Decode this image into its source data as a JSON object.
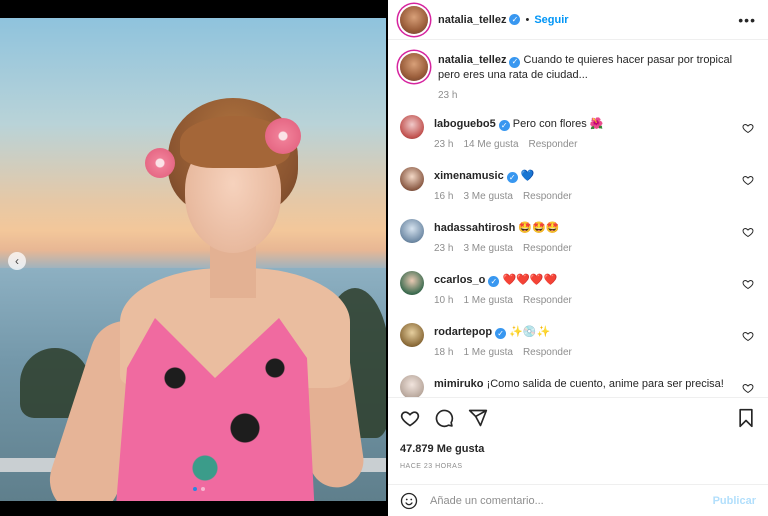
{
  "post": {
    "author": "natalia_tellez",
    "follow_label": "Seguir",
    "separator": "•",
    "more_label": "•••"
  },
  "caption": {
    "username": "natalia_tellez",
    "text": "Cuando te quieres hacer pasar por tropical pero eres una rata de ciudad...",
    "time": "23 h"
  },
  "comments": [
    {
      "username": "laboguebo5",
      "text": "Pero con flores 🌺",
      "time": "23 h",
      "likes": "14 Me gusta",
      "reply": "Responder",
      "verified": true
    },
    {
      "username": "ximenamusic",
      "text": "💙",
      "time": "16 h",
      "likes": "3 Me gusta",
      "reply": "Responder",
      "verified": true
    },
    {
      "username": "hadassahtirosh",
      "text": "🤩🤩🤩",
      "time": "23 h",
      "likes": "3 Me gusta",
      "reply": "Responder",
      "verified": false
    },
    {
      "username": "ccarlos_o",
      "text": "❤️❤️❤️❤️",
      "time": "10 h",
      "likes": "1 Me gusta",
      "reply": "Responder",
      "verified": true
    },
    {
      "username": "rodartepop",
      "text": "✨💿✨",
      "time": "18 h",
      "likes": "1 Me gusta",
      "reply": "Responder",
      "verified": true
    },
    {
      "username": "mimiruko",
      "text": "¡Como salida de cuento, anime para ser precisa!",
      "time": "",
      "likes": "",
      "reply": "",
      "verified": false
    }
  ],
  "actions": {
    "likes": "47.879 Me gusta",
    "ago": "HACE 23 HORAS"
  },
  "composer": {
    "placeholder": "Añade un comentario...",
    "publish": "Publicar"
  },
  "icons": {
    "heart": "heart-icon",
    "comment": "comment-icon",
    "share": "share-icon",
    "bookmark": "bookmark-icon",
    "emoji": "emoji-icon",
    "carousel_prev": "chevron-left-icon"
  },
  "colors": {
    "accent": "#0095f6",
    "verified": "#3897f0",
    "publish_disabled": "#b2dffc"
  }
}
